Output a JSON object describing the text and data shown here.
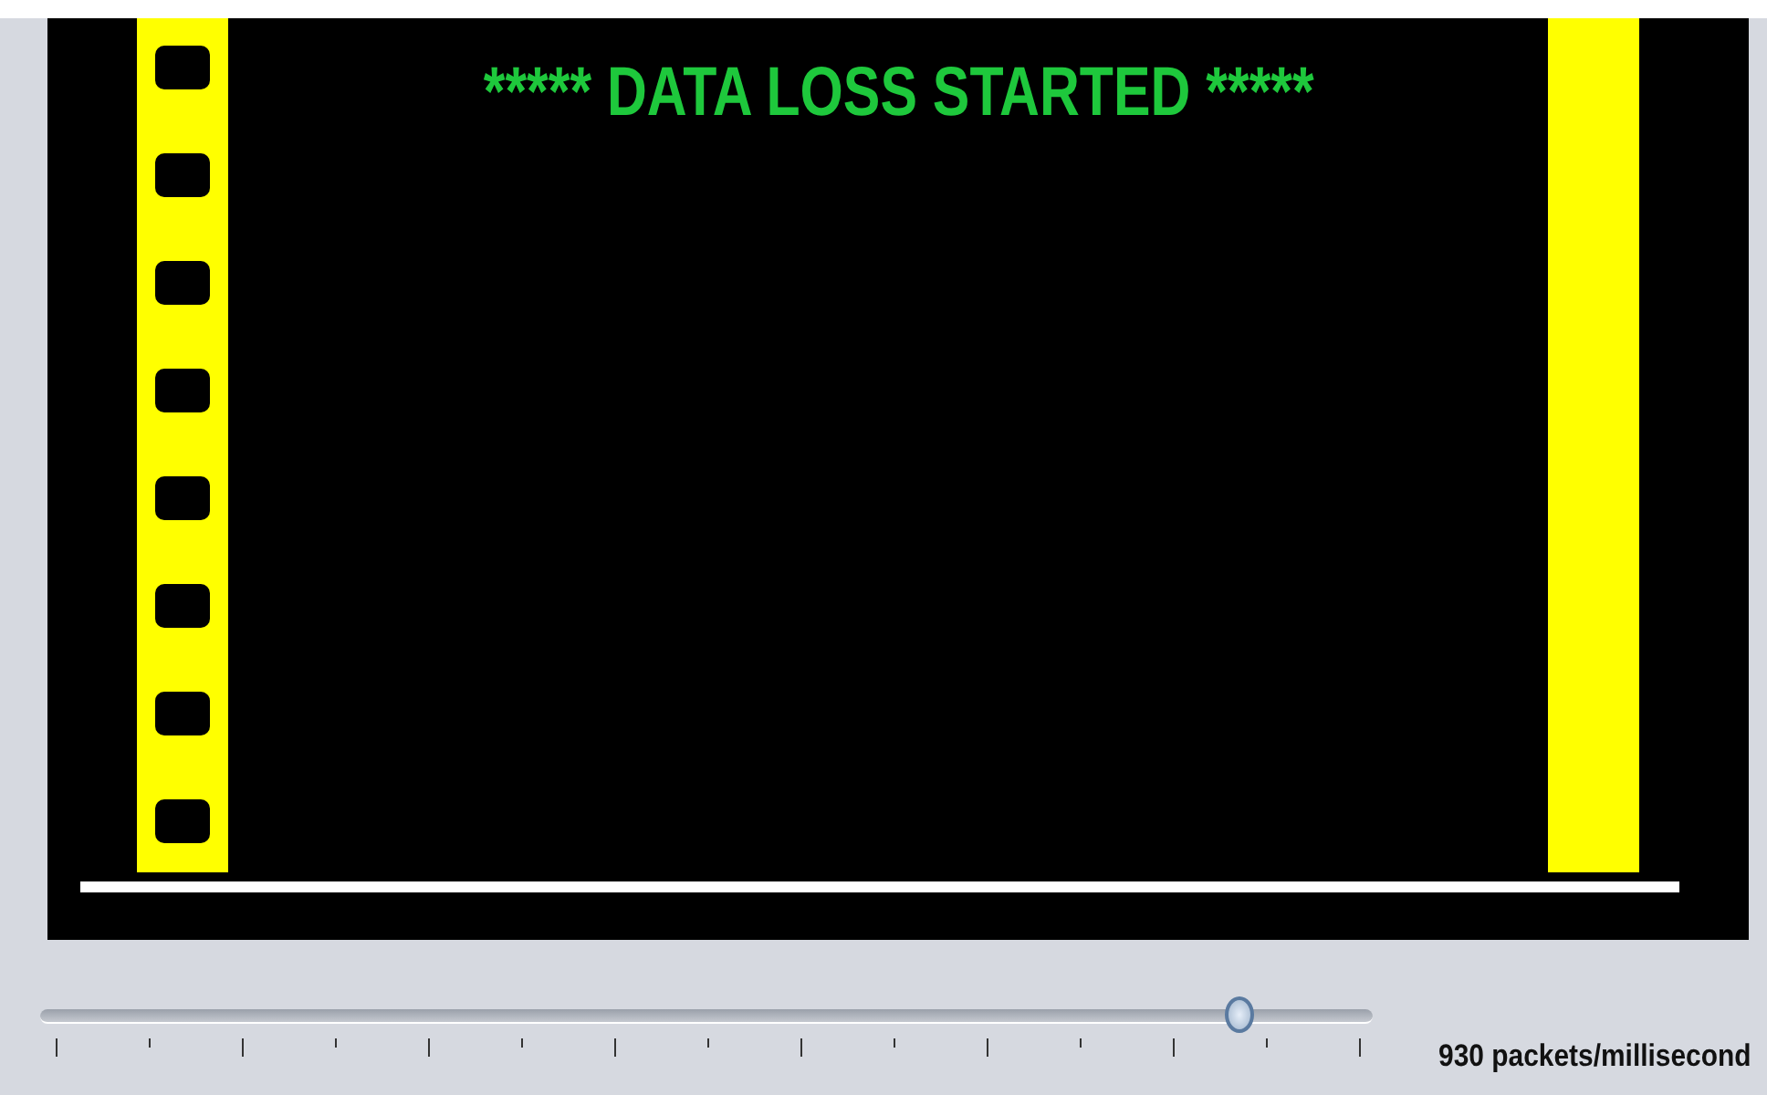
{
  "banner": {
    "text": "***** DATA LOSS STARTED *****"
  },
  "slider": {
    "level": 0.9,
    "reading": "930 packets/millisecond"
  }
}
